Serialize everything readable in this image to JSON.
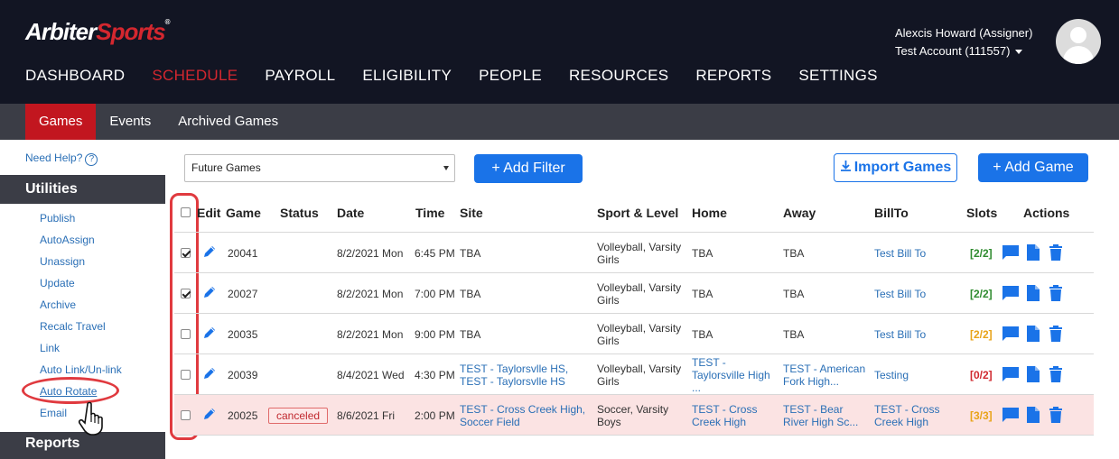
{
  "brand": {
    "logo_a": "Arbiter",
    "logo_b": "Sports",
    "tm": "®"
  },
  "user": {
    "name": "Alexcis Howard (Assigner)",
    "account": "Test Account (111557)"
  },
  "nav": {
    "items": [
      "DASHBOARD",
      "SCHEDULE",
      "PAYROLL",
      "ELIGIBILITY",
      "PEOPLE",
      "RESOURCES",
      "REPORTS",
      "SETTINGS"
    ],
    "active": "SCHEDULE"
  },
  "subnav": {
    "items": [
      "Games",
      "Events",
      "Archived Games"
    ],
    "active": "Games"
  },
  "sidebar": {
    "help": "Need Help?",
    "help_icon": "?",
    "utilities_title": "Utilities",
    "links": [
      "Publish",
      "AutoAssign",
      "Unassign",
      "Update",
      "Archive",
      "Recalc Travel",
      "Link",
      "Auto Link/Un-link",
      "Auto Rotate",
      "Email"
    ],
    "reports_title": "Reports"
  },
  "toolbar": {
    "filter_select": "Future Games",
    "add_filter": "+ Add Filter",
    "import_games": "Import Games",
    "add_game": "+ Add Game"
  },
  "table": {
    "headers": [
      "Edit",
      "Game",
      "Status",
      "Date",
      "Time",
      "Site",
      "Sport & Level",
      "Home",
      "Away",
      "BillTo",
      "Slots",
      "Actions"
    ],
    "rows": [
      {
        "checked": true,
        "game": "20041",
        "status": "",
        "date": "8/2/2021 Mon",
        "time": "6:45 PM",
        "site": "TBA",
        "site2": "",
        "sport": "Volleyball, Varsity",
        "sport2": "Girls",
        "home": "TBA",
        "home2": "",
        "home3": "",
        "away": "TBA",
        "away2": "",
        "billto": "Test Bill To",
        "billto2": "",
        "slots": "[2/2]",
        "slot_color": "#2e8b2e"
      },
      {
        "checked": true,
        "game": "20027",
        "status": "",
        "date": "8/2/2021 Mon",
        "time": "7:00 PM",
        "site": "TBA",
        "site2": "",
        "sport": "Volleyball, Varsity",
        "sport2": "Girls",
        "home": "TBA",
        "home2": "",
        "home3": "",
        "away": "TBA",
        "away2": "",
        "billto": "Test Bill To",
        "billto2": "",
        "slots": "[2/2]",
        "slot_color": "#2e8b2e"
      },
      {
        "checked": false,
        "game": "20035",
        "status": "",
        "date": "8/2/2021 Mon",
        "time": "9:00 PM",
        "site": "TBA",
        "site2": "",
        "sport": "Volleyball, Varsity",
        "sport2": "Girls",
        "home": "TBA",
        "home2": "",
        "home3": "",
        "away": "TBA",
        "away2": "",
        "billto": "Test Bill To",
        "billto2": "",
        "slots": "[2/2]",
        "slot_color": "#e8a317"
      },
      {
        "checked": false,
        "game": "20039",
        "status": "",
        "date": "8/4/2021 Wed",
        "time": "4:30 PM",
        "site": "TEST - Taylorsvlle HS,",
        "site2": "TEST - Taylorsvlle HS",
        "sport": "Volleyball, Varsity",
        "sport2": "Girls",
        "home": "TEST -",
        "home2": "Taylorsville High",
        "home3": "...",
        "away": "TEST - American",
        "away2": "Fork High...",
        "billto": "Testing",
        "billto2": "",
        "slots": "[0/2]",
        "slot_color": "#d0282e"
      },
      {
        "checked": false,
        "game": "20025",
        "status": "canceled",
        "date": "8/6/2021 Fri",
        "time": "2:00 PM",
        "site": "TEST - Cross Creek High,",
        "site2": "Soccer Field",
        "sport": "Soccer, Varsity",
        "sport2": "Boys",
        "home": "TEST - Cross",
        "home2": "Creek High",
        "home3": "",
        "away": "TEST - Bear",
        "away2": "River High Sc...",
        "billto": "TEST - Cross",
        "billto2": "Creek High",
        "slots": "[3/3]",
        "slot_color": "#e8a317"
      }
    ]
  }
}
